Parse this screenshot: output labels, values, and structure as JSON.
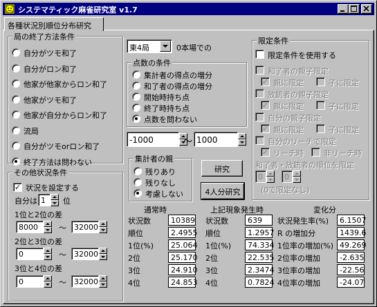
{
  "window": {
    "title": "システマティック麻雀研究室  v1.7",
    "tab": "各種状況別順位分布研究"
  },
  "end_condition": {
    "legend": "局の終了方法条件",
    "options": [
      "自分がツモ和了",
      "自分がロン和了",
      "他家が他家からロン和了",
      "他家がツモ和了",
      "他家が自分からロン和了",
      "流局",
      "自分がツモorロン和了",
      "終了方法は問わない"
    ],
    "selected": "終了方法は問わない"
  },
  "other_conditions": {
    "legend": "その他状況条件",
    "use_label": "状況を設定する",
    "use_checked": true,
    "self_is_label": "自分は",
    "self_rank": "1",
    "rank_suffix": "位",
    "diff12_label": "1位と2位の差",
    "diff23_label": "2位と3位の差",
    "diff34_label": "3位と4位の差",
    "tilde": "～",
    "diff12_min": "8000",
    "diff12_max": "32000",
    "diff23_min": "0",
    "diff23_max": "32000",
    "diff34_min": "0",
    "diff34_max": "32000"
  },
  "round": {
    "value": "東4局",
    "honba_label": "0本場での"
  },
  "score_condition": {
    "legend": "点数の条件",
    "options": [
      "集計者の得点の増分",
      "和了者の得点の増分",
      "開始時持ち点",
      "終了時持ち点",
      "点数を問わない"
    ],
    "selected": "点数を問わない",
    "min": "-1000",
    "max": "1000",
    "tilde": "～"
  },
  "dealer": {
    "legend": "集計者の親",
    "options": [
      "残りあり",
      "残りなし",
      "考慮しない"
    ],
    "selected": "考慮しない"
  },
  "buttons": {
    "research": "研究",
    "four_player": "4人分研究"
  },
  "limits": {
    "legend": "限定条件",
    "use_label": "限定条件を使用する",
    "winner_parent_label": "和了者の親子限定",
    "dealin_parent_label": "放銃者の親子限定",
    "own_parent_label": "自分の親子限定",
    "riichi_label": "自分のリーチで限定",
    "parent_label": "親に限定",
    "child_label": "子に限定",
    "riichi_on_label": "リーチ時",
    "riichi_off_label": "非リーチ時",
    "rank_label": "和了者・放銃者の順位を限定",
    "rank_winner": "0",
    "rank_dealin": "0",
    "note": "(0で限定なし)"
  },
  "results": {
    "normal_header": "通常時",
    "event_header": "上記現象発生時",
    "change_header": "変化分",
    "row_labels_normal": [
      "状況数",
      "順位",
      "1位(%)",
      "2位",
      "3位",
      "4位"
    ],
    "normal_values": [
      "10389",
      "2.4955",
      "25.064",
      "25.170",
      "24.910",
      "24.853"
    ],
    "row_labels_event": [
      "状況数",
      "順位",
      "1位(%)",
      "2位",
      "3位",
      "4位"
    ],
    "event_values": [
      "639",
      "1.2957",
      "74.334",
      "22.535",
      "2.3474",
      "0.7824"
    ],
    "change_labels": [
      "状況発生率(%)",
      "R の増加分",
      "1位率の増加(%)",
      "2位率の増加",
      "3位率の増加",
      "4位率の増加"
    ],
    "change_values": [
      "6.1507",
      "1439.6",
      "49.269",
      "-2.635",
      "-22.56",
      "-24.07"
    ]
  }
}
